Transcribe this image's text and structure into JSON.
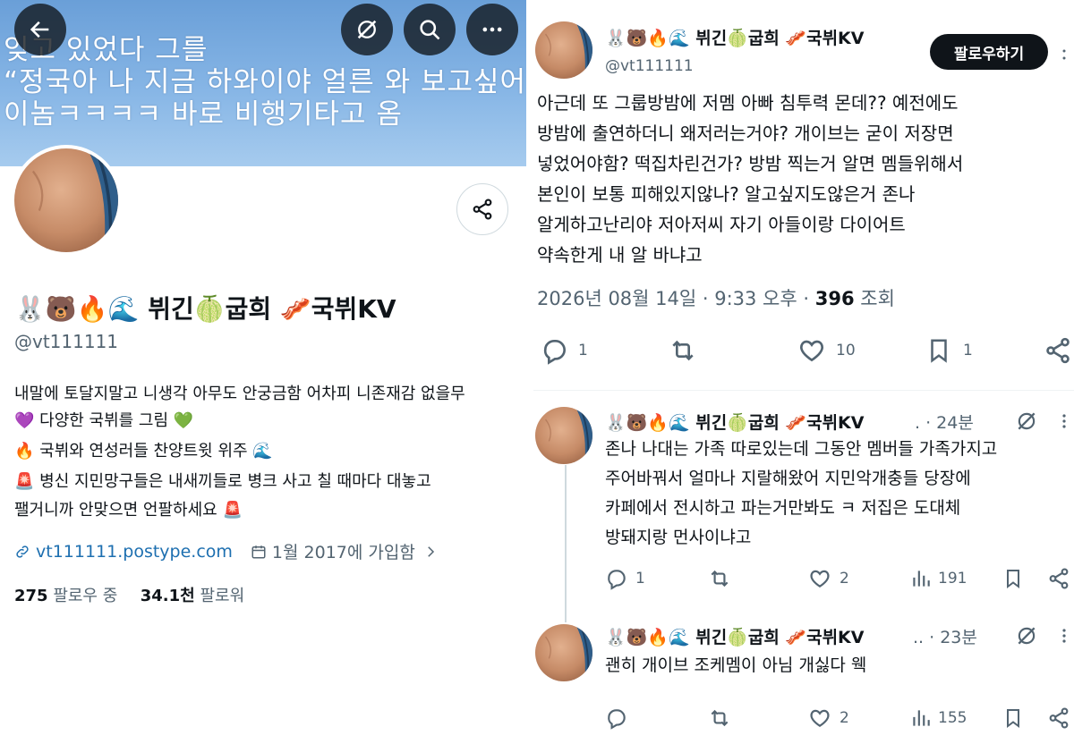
{
  "colors": {
    "banner": "#87b6e6",
    "text": "#0f1419",
    "muted": "#536471",
    "link": "#1d6fb0",
    "button_dark": "#0f1419"
  },
  "profile": {
    "banner_lines": [
      "잊고 있었다 그를",
      "“정국아 나 지금 하와이야 얼른 와 보고싶어”",
      "이놈ㅋㅋㅋㅋ 바로 비행기타고 옴"
    ],
    "name": "🐰🐻🔥🌊 뷔긴🍈굽희 🥓국뷔KV",
    "handle": "@vt111111",
    "bio": [
      "내말에 토달지말고 니생각 아무도 안궁금함 어차피 니존재감 없을무",
      "💜 다양한 국뷔를 그림 💚",
      "🔥 국뷔와 연성러들 찬양트윗 위주 🌊",
      "🚨 병신 지민망구들은 내새끼들로 병크 사고 칠 때마다 대놓고",
      "팰거니까 안맞으면 언팔하세요 🚨"
    ],
    "link": "vt111111.postype.com",
    "joined": "1월 2017에 가입함",
    "following_count": "275",
    "following_label": "팔로우 중",
    "followers_count": "34.1천",
    "followers_label": "팔로워"
  },
  "tweet": {
    "name": "🐰🐻🔥🌊 뷔긴🍈굽희 🥓국뷔KV",
    "handle": "@vt111111",
    "follow_label": "팔로우하기",
    "text_lines": [
      "아근데 또 그룹방밤에 저멤 아빠 침투력 몬데?? 예전에도",
      "방밤에 출연하더니 왜저러는거야? 개이브는 굳이 저장면",
      "넣었어야함? 떡집차린건가? 방밤 찍는거 알면 멤들위해서",
      "본인이 보통 피해있지않나? 알고싶지도않은거 존나",
      "알게하고난리야 저아저씨 자기 아들이랑 다이어트",
      "약속한게  내 알 바냐고"
    ],
    "timestamp": "2026년 08월 14일 · 9:33 오후 · ",
    "views": "396",
    "views_label": "조회",
    "replies": "1",
    "retweets": "",
    "likes": "10",
    "bookmarks": "1"
  },
  "replies": [
    {
      "name": "🐰🐻🔥🌊 뷔긴🍈굽희 🥓국뷔KV",
      "handle_suffix": ". · 24분",
      "text_lines": [
        "존나 나대는 가족 따로있는데 그동안 멤버들 가족가지고",
        "주어바꿔서 얼마나 지랄해왔어 지민악개충들 당장에",
        "카페에서 전시하고 파는거만봐도 ㅋ 저집은 도대체",
        "방돼지랑 먼사이냐고"
      ],
      "replies": "1",
      "likes": "2",
      "views": "191"
    },
    {
      "name": "🐰🐻🔥🌊 뷔긴🍈굽희 🥓국뷔KV",
      "handle_suffix": ".. · 23분",
      "text_lines": [
        "괜히 개이브 조케멤이 아님 개싫다 웩"
      ],
      "replies": "",
      "likes": "2",
      "views": "155"
    }
  ],
  "icons": [
    "back-arrow-icon",
    "grok-icon",
    "search-icon",
    "more-icon",
    "share-icon",
    "link-icon",
    "calendar-icon",
    "chevron-right-icon",
    "reply-icon",
    "retweet-icon",
    "like-icon",
    "bookmark-icon",
    "views-icon"
  ]
}
